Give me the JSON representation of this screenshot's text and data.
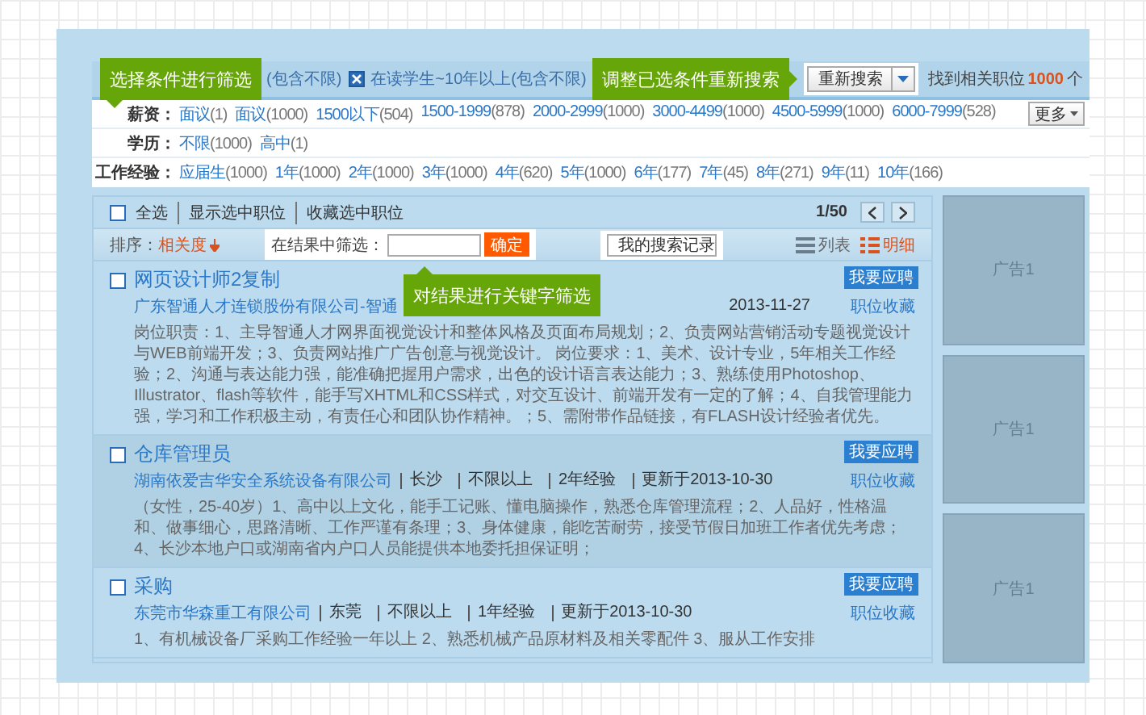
{
  "selected_conditions": [
    "(包含不限)",
    "在读学生~10年以上(包含不限)"
  ],
  "research_button": {
    "label": "重新搜索"
  },
  "result_count": {
    "label": "找到相关职位",
    "count": "1000",
    "unit": "个"
  },
  "filters": [
    {
      "label": "薪资：",
      "more": "更多",
      "options": [
        {
          "value": "面议",
          "count": "(1)"
        },
        {
          "value": "面议",
          "count": "(1000)"
        },
        {
          "value": "1500以下",
          "count": "(504)"
        },
        {
          "value": "1500-1999",
          "count": "(878)"
        },
        {
          "value": "2000-2999",
          "count": "(1000)"
        },
        {
          "value": "3000-4499",
          "count": "(1000)"
        },
        {
          "value": "4500-5999",
          "count": "(1000)"
        },
        {
          "value": "6000-7999",
          "count": "(528)"
        }
      ]
    },
    {
      "label": "学历：",
      "options": [
        {
          "value": "不限",
          "count": "(1000)"
        },
        {
          "value": "高中",
          "count": "(1)"
        }
      ]
    },
    {
      "label": "工作经验：",
      "options": [
        {
          "value": "应届生",
          "count": "(1000)"
        },
        {
          "value": "1年",
          "count": "(1000)"
        },
        {
          "value": "2年",
          "count": "(1000)"
        },
        {
          "value": "3年",
          "count": "(1000)"
        },
        {
          "value": "4年",
          "count": "(620)"
        },
        {
          "value": "5年",
          "count": "(1000)"
        },
        {
          "value": "6年",
          "count": "(177)"
        },
        {
          "value": "7年",
          "count": "(45)"
        },
        {
          "value": "8年",
          "count": "(271)"
        },
        {
          "value": "9年",
          "count": "(11)"
        },
        {
          "value": "10年",
          "count": "(166)"
        }
      ]
    }
  ],
  "list_toolbar": {
    "select_all": {
      "label": "全选",
      "checked": false
    },
    "actions": [
      "显示选中职位",
      "收藏选中职位"
    ],
    "page": "1/50"
  },
  "sort": {
    "label": "排序：",
    "value": "相关度"
  },
  "keyword_filter": {
    "label": "在结果中筛选：",
    "button": "确定"
  },
  "search_history": {
    "value": "我的搜索记录"
  },
  "views": [
    {
      "label": "列表",
      "selected": false
    },
    {
      "label": "明细",
      "selected": true
    }
  ],
  "jobs": [
    {
      "title": "网页设计师2复制",
      "checked": false,
      "highlighted": false,
      "company": "广东智通人才连锁股份有限公司-智通",
      "meta": [
        "2013-11-27"
      ],
      "description": "岗位职责：1、主导智通人才网界面视觉设计和整体风格及页面布局规划；2、负责网站营销活动专题视觉设计与WEB前端开发；3、负责网站推广广告创意与视觉设计。 岗位要求：1、美术、设计专业，5年相关工作经验；2、沟通与表达能力强，能准确把握用户需求，出色的设计语言表达能力；3、熟练使用Photoshop、Illustrator、flash等软件，能手写XHTML和CSS样式，对交互设计、前端开发有一定的了解；4、自我管理能力强，学习和工作积极主动，有责任心和团队协作精神。；5、需附带作品链接，有FLASH设计经验者优先。",
      "apply": "我要应聘",
      "save": "职位收藏"
    },
    {
      "title": "仓库管理员",
      "checked": false,
      "highlighted": true,
      "company": "湖南依爱吉华安全系统设备有限公司",
      "meta": [
        "长沙",
        "不限以上",
        "2年经验",
        "更新于2013-10-30"
      ],
      "description": "（女性，25-40岁）1、高中以上文化，能手工记账、懂电脑操作，熟悉仓库管理流程；2、人品好，性格温和、做事细心，思路清晰、工作严谨有条理；3、身体健康，能吃苦耐劳，接受节假日加班工作者优先考虑；4、长沙本地户口或湖南省内户口人员能提供本地委托担保证明；",
      "apply": "我要应聘",
      "save": "职位收藏"
    },
    {
      "title": "采购",
      "checked": false,
      "highlighted": false,
      "company": "东莞市华森重工有限公司",
      "meta": [
        "东莞",
        "不限以上",
        "1年经验",
        "更新于2013-10-30"
      ],
      "description": "1、有机械设备厂采购工作经验一年以上 2、熟悉机械产品原材料及相关零配件 3、服从工作安排",
      "apply": "我要应聘",
      "save": "职位收藏"
    }
  ],
  "ads": [
    "广告1",
    "广告1",
    "广告1"
  ],
  "callouts": [
    {
      "text": "选择条件进行筛选",
      "kind": "down"
    },
    {
      "text": "调整已选条件重新搜索",
      "kind": "right"
    },
    {
      "text": "对结果进行关键字筛选",
      "kind": "up"
    }
  ]
}
